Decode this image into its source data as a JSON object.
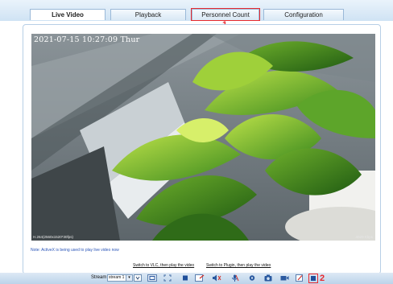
{
  "tabs": [
    {
      "label": "Live Video",
      "active": true
    },
    {
      "label": "Playback",
      "active": false
    },
    {
      "label": "Personnel Count",
      "active": false
    },
    {
      "label": "Configuration",
      "active": false
    }
  ],
  "annotations": {
    "marker_1": "1",
    "marker_2": "2",
    "highlight_color": "#e8292e"
  },
  "video": {
    "timestamp": "2021-07-15 10:27:09 Thur",
    "info_left": "H.264(2560x1520*30fps)",
    "info_right": "4020 Kbps"
  },
  "note": "Note: ActiveX is being used to play live video now",
  "links": {
    "vlc": "Switch to VLC, then play the video",
    "plugin": "Switch to Plugin, then play the video"
  },
  "toolbar": {
    "stream_label": "Stream",
    "stream_value": "stream 1",
    "icons": [
      "stream-dropdown-icon",
      "fit-window-icon",
      "full-screen-icon",
      "stop-icon",
      "snapshot-icon",
      "audio-icon",
      "microphone-icon",
      "settings-icon",
      "camera-icon",
      "record-icon",
      "list-icon",
      "edit-icon",
      "window-stop-icon"
    ]
  },
  "colors": {
    "accent": "#2a55b8",
    "tab_border": "#9ab9d8"
  }
}
